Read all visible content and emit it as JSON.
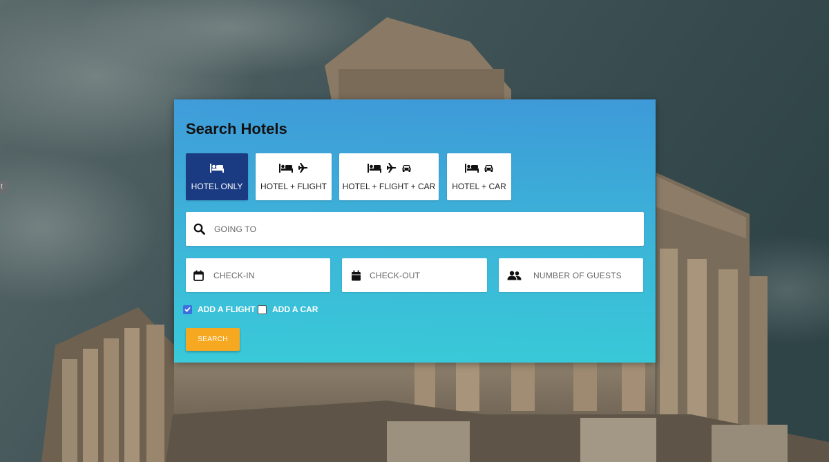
{
  "side_tab": {
    "label": "t"
  },
  "panel": {
    "title": "Search Hotels",
    "tabs": [
      {
        "label": "HOTEL ONLY",
        "icons": [
          "bed-icon"
        ],
        "active": true
      },
      {
        "label": "HOTEL + FLIGHT",
        "icons": [
          "bed-icon",
          "plane-icon"
        ],
        "active": false
      },
      {
        "label": "HOTEL + FLIGHT + CAR",
        "icons": [
          "bed-icon",
          "plane-icon",
          "car-icon"
        ],
        "active": false
      },
      {
        "label": "HOTEL + CAR",
        "icons": [
          "bed-icon",
          "car-icon"
        ],
        "active": false
      }
    ],
    "destination": {
      "placeholder": "GOING TO",
      "icon": "search-icon",
      "value": ""
    },
    "check_in": {
      "placeholder": "CHECK-IN",
      "icon": "calendar-outline-icon",
      "value": ""
    },
    "check_out": {
      "placeholder": "CHECK-OUT",
      "icon": "calendar-filled-icon",
      "value": ""
    },
    "guests": {
      "placeholder": "NUMBER OF GUESTS",
      "icon": "users-icon",
      "value": ""
    },
    "options": [
      {
        "label": "ADD A FLIGHT",
        "checked": true
      },
      {
        "label": "ADD A CAR",
        "checked": false
      }
    ],
    "search_button": {
      "label": "SEARCH"
    }
  },
  "colors": {
    "active_tab": "#1a3a82",
    "panel_top": "#3ea0e2",
    "panel_bottom": "#39d4e4",
    "search_button": "#f6a821",
    "checkbox_checked": "#3b6fe0"
  }
}
